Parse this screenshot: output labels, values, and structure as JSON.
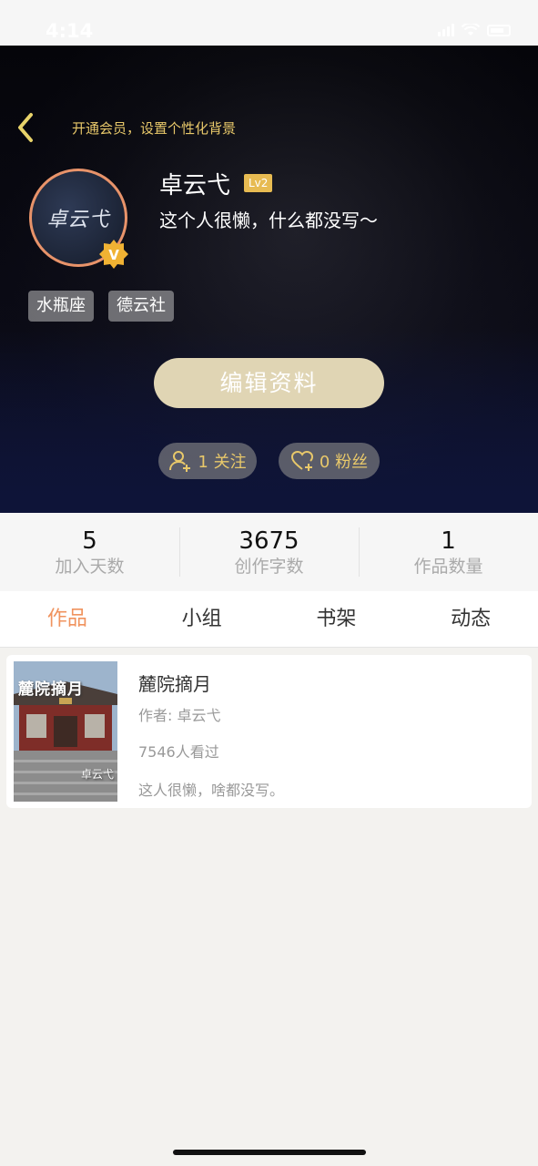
{
  "status_bar": {
    "time": "4:14"
  },
  "header": {
    "bg_hint": "开通会员，设置个性化背景"
  },
  "profile": {
    "avatar_text": "卓云弋",
    "username": "卓云弋",
    "level": "Lv2",
    "bio": "这个人很懒，什么都没写～",
    "tags": [
      "水瓶座",
      "德云社"
    ],
    "edit_label": "编辑资料",
    "following_label": "1 关注",
    "fans_label": "0 粉丝"
  },
  "stats": [
    {
      "value": "5",
      "label": "加入天数"
    },
    {
      "value": "3675",
      "label": "创作字数"
    },
    {
      "value": "1",
      "label": "作品数量"
    }
  ],
  "tabs": [
    {
      "label": "作品",
      "active": true
    },
    {
      "label": "小组"
    },
    {
      "label": "书架"
    },
    {
      "label": "动态"
    }
  ],
  "works": [
    {
      "cover_title": "麓院摘月",
      "cover_author": "卓云弋",
      "title": "麓院摘月",
      "author": "作者: 卓云弋",
      "views": "7546人看过",
      "description": "这人很懒，啥都没写。"
    }
  ],
  "colors": {
    "accent": "#f0935e",
    "gold": "#e8c86a",
    "edit_button": "#e0d5b4",
    "level_badge": "#e7bb52"
  },
  "icons": [
    "back-chevron-icon",
    "verified-v-icon",
    "user-plus-icon",
    "heart-plus-icon",
    "signal-icon",
    "wifi-icon",
    "battery-icon"
  ]
}
